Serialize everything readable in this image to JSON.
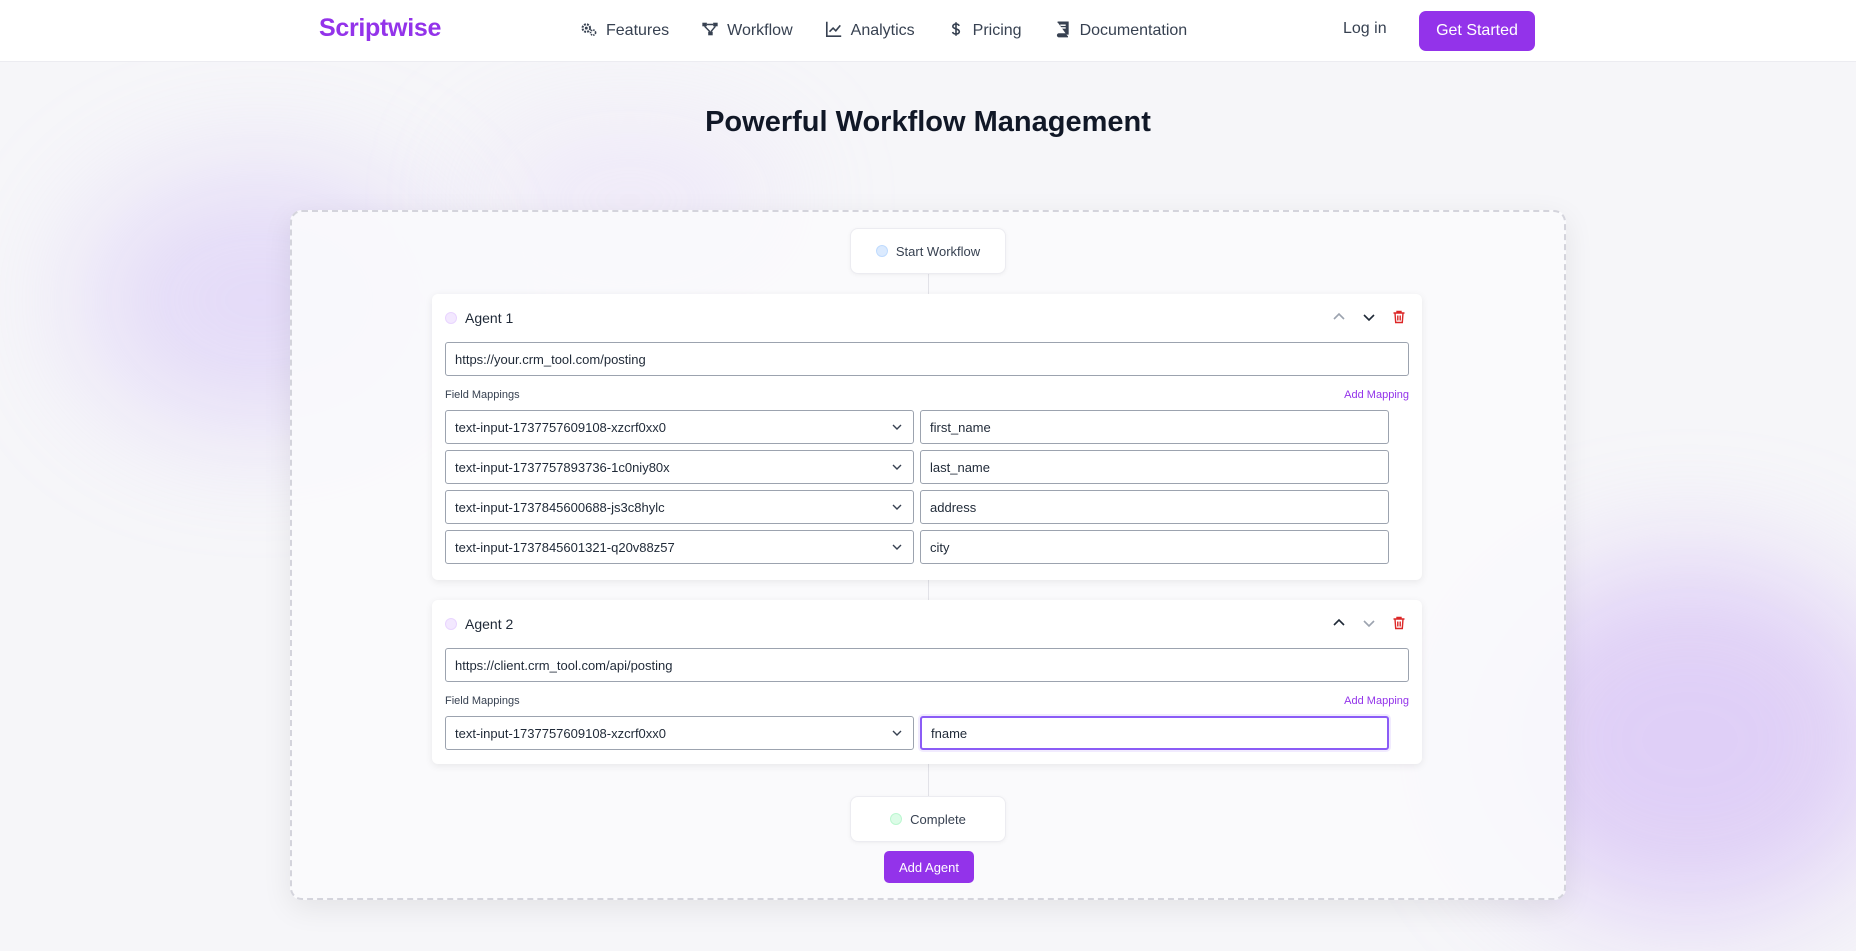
{
  "brand": {
    "name": "Scriptwise",
    "color": "#9333ea"
  },
  "nav": [
    {
      "label": "Features",
      "icon": "gears-icon"
    },
    {
      "label": "Workflow",
      "icon": "workflow-icon"
    },
    {
      "label": "Analytics",
      "icon": "chart-line-icon"
    },
    {
      "label": "Pricing",
      "icon": "dollar-icon"
    },
    {
      "label": "Documentation",
      "icon": "book-icon"
    }
  ],
  "auth": {
    "login": "Log in",
    "cta": "Get Started"
  },
  "page": {
    "title": "Powerful Workflow Management"
  },
  "workflow": {
    "start_label": "Start Workflow",
    "complete_label": "Complete",
    "add_agent_label": "Add Agent",
    "agents": [
      {
        "name": "Agent 1",
        "url": "https://your.crm_tool.com/posting",
        "field_mappings_label": "Field Mappings",
        "add_mapping_label": "Add Mapping",
        "mappings": [
          {
            "source": "text-input-1737757609108-xzcrf0xx0",
            "target": "first_name"
          },
          {
            "source": "text-input-1737757893736-1c0niy80x",
            "target": "last_name"
          },
          {
            "source": "text-input-1737845600688-js3c8hylc",
            "target": "address"
          },
          {
            "source": "text-input-1737845601321-q20v88z57",
            "target": "city"
          }
        ]
      },
      {
        "name": "Agent 2",
        "url": "https://client.crm_tool.com/api/posting",
        "field_mappings_label": "Field Mappings",
        "add_mapping_label": "Add Mapping",
        "mappings": [
          {
            "source": "text-input-1737757609108-xzcrf0xx0",
            "target": "fname"
          }
        ]
      }
    ]
  },
  "colors": {
    "accent": "#9333ea",
    "focus": "#8b5cf6",
    "delete": "#dc2626",
    "start_dot": "#dbeafe",
    "complete_dot": "#dcfce7"
  }
}
